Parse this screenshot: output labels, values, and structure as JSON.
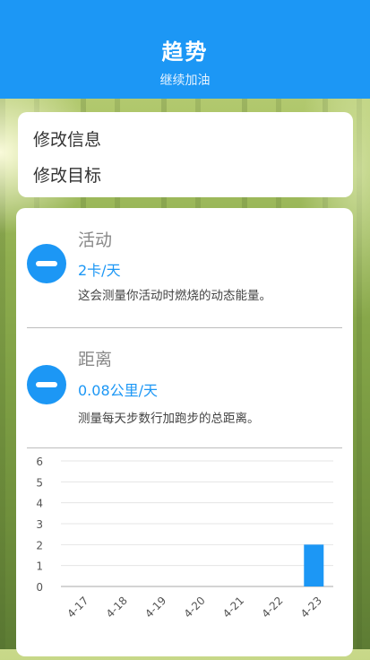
{
  "header": {
    "title": "趋势",
    "subtitle": "继续加油",
    "background_color": "#1c97f5"
  },
  "menu": {
    "items": [
      {
        "label": "修改信息"
      },
      {
        "label": "修改目标"
      }
    ]
  },
  "metrics": {
    "activity": {
      "title": "活动",
      "value": "2卡/天",
      "description": "这会测量你活动时燃烧的动态能量。",
      "button_icon": "minus-icon"
    },
    "distance": {
      "title": "距离",
      "value": "0.08公里/天",
      "description": "测量每天步数行加跑步的总距离。",
      "button_icon": "minus-icon"
    }
  },
  "chart_data": {
    "type": "bar",
    "categories": [
      "4-17",
      "4-18",
      "4-19",
      "4-20",
      "4-21",
      "4-22",
      "4-23"
    ],
    "values": [
      0,
      0,
      0,
      0,
      0,
      0,
      2
    ],
    "yticks": [
      0,
      1,
      2,
      3,
      4,
      5,
      6
    ],
    "ylim": [
      0,
      6
    ],
    "grid": true,
    "bar_color": "#1c97f5"
  }
}
